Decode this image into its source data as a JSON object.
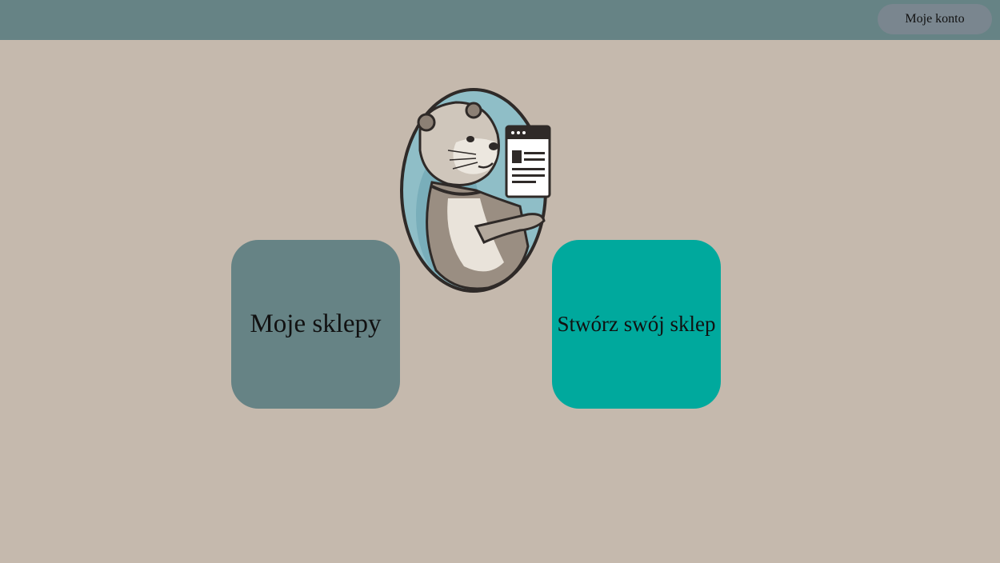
{
  "header": {
    "account_button_label": "Moje konto"
  },
  "mascot": {
    "icon": "otter-with-browser-window-icon"
  },
  "tiles": {
    "my_shops_label": "Moje sklepy",
    "create_shop_label": "Stwórz swój sklep"
  },
  "colors": {
    "background": "#c5b9ad",
    "header": "#668385",
    "account_button": "#7a868f",
    "my_shops_tile": "#668385",
    "create_shop_tile": "#00a99d"
  }
}
